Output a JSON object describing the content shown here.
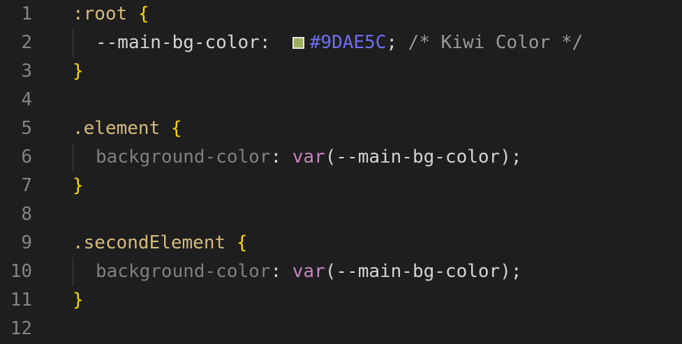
{
  "editor": {
    "swatch_color": "#9DAE5C",
    "lines": [
      {
        "num": "1",
        "selector": ":root",
        "brace": "{"
      },
      {
        "num": "2",
        "prop": "--main-bg-color",
        "colon": ":",
        "value": "#9DAE5C",
        "semicolon": ";",
        "comment": "/* Kiwi Color */"
      },
      {
        "num": "3",
        "brace": "}"
      },
      {
        "num": "4"
      },
      {
        "num": "5",
        "selector": ".element",
        "brace": "{"
      },
      {
        "num": "6",
        "prop": "background-color",
        "colon": ":",
        "func": "var",
        "open": "(",
        "arg": "--main-bg-color",
        "close": ");"
      },
      {
        "num": "7",
        "brace": "}"
      },
      {
        "num": "8"
      },
      {
        "num": "9",
        "selector": ".secondElement",
        "brace": "{"
      },
      {
        "num": "10",
        "prop": "background-color",
        "colon": ":",
        "func": "var",
        "open": "(",
        "arg": "--main-bg-color",
        "close": ");"
      },
      {
        "num": "11",
        "brace": "}"
      },
      {
        "num": "12"
      }
    ]
  }
}
